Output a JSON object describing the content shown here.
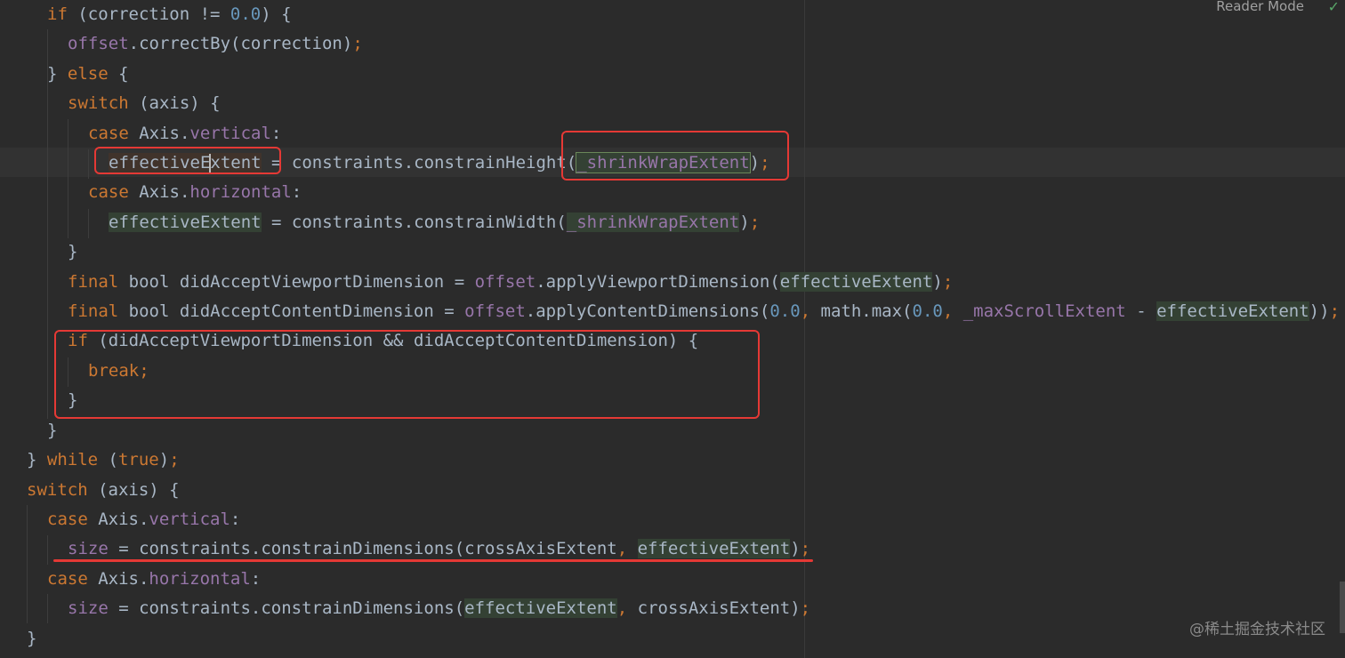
{
  "toolbar": {
    "reader_mode_label": "Reader Mode",
    "check_icon": "check-icon"
  },
  "code": {
    "line1": {
      "kw_if": "if",
      "open": " (correction != ",
      "num": "0.0",
      "close": ") {"
    },
    "line2": {
      "fld": "offset",
      "rest": ".correctBy(correction)",
      "semi": ";"
    },
    "line3": {
      "close": "} ",
      "kw_else": "else",
      "open": " {"
    },
    "line4": {
      "kw_switch": "switch",
      "rest": " (axis) {"
    },
    "line5": {
      "kw_case": "case",
      "type": " Axis.",
      "fld": "vertical",
      "colon": ":"
    },
    "line6": {
      "var_before": "effectiveE",
      "var_after": "xtent",
      "mid": " = constraints.constrainHeight(",
      "arg": "_shrinkWrapExtent",
      "close": ")",
      "semi": ";"
    },
    "line7": {
      "kw_case": "case",
      "type": " Axis.",
      "fld": "horizontal",
      "colon": ":"
    },
    "line8": {
      "var": "effectiveExtent",
      "mid": " = constraints.constrainWidth(",
      "arg": "_shrinkWrapExtent",
      "close": ")",
      "semi": ";"
    },
    "line9": {
      "close": "}"
    },
    "line10": {
      "kw_final": "final",
      "decl": " bool didAcceptViewportDimension = ",
      "fld": "offset",
      "call": ".applyViewportDimension(",
      "arg": "effectiveExtent",
      "close": ")",
      "semi": ";"
    },
    "line11": {
      "kw_final": "final",
      "decl": " bool didAcceptContentDimension = ",
      "fld": "offset",
      "call": ".applyContentDimensions(",
      "num1": "0.0",
      "comma1": ", ",
      "math": "math.max(",
      "num2": "0.0",
      "comma2": ", ",
      "fld2": "_maxScrollExtent",
      "minus": " - ",
      "arg": "effectiveExtent",
      "close": "))",
      "semi": ";"
    },
    "line12": {
      "kw_if": "if",
      "rest": " (didAcceptViewportDimension && didAcceptContentDimension) {"
    },
    "line13": {
      "kw_break": "break",
      "semi": ";"
    },
    "line14": {
      "close": "}"
    },
    "line15": {
      "close": "}"
    },
    "line16": {
      "close": "} ",
      "kw_while": "while",
      "open": " (",
      "kw_true": "true",
      "end": ")",
      "semi": ";"
    },
    "line17": {
      "kw_switch": "switch",
      "rest": " (axis) {"
    },
    "line18": {
      "kw_case": "case",
      "type": " Axis.",
      "fld": "vertical",
      "colon": ":"
    },
    "line19": {
      "fld": "size",
      "mid": " = constraints.constrainDimensions(crossAxisExtent",
      "comma": ", ",
      "arg": "effectiveExtent",
      "close": ")",
      "semi": ";"
    },
    "line20": {
      "kw_case": "case",
      "type": " Axis.",
      "fld": "horizontal",
      "colon": ":"
    },
    "line21": {
      "fld": "size",
      "mid": " = constraints.constrainDimensions(",
      "arg": "effectiveExtent",
      "comma": ", ",
      "rest": "crossAxisExtent)",
      "semi": ";"
    },
    "line22": {
      "close": "}"
    }
  },
  "watermark": "@稀土掘金技术社区",
  "colors": {
    "background": "#2b2b2b",
    "keyword": "#cc7832",
    "number": "#6897bb",
    "field": "#9876aa",
    "text": "#a9b7c6",
    "annotation": "#e53935"
  }
}
